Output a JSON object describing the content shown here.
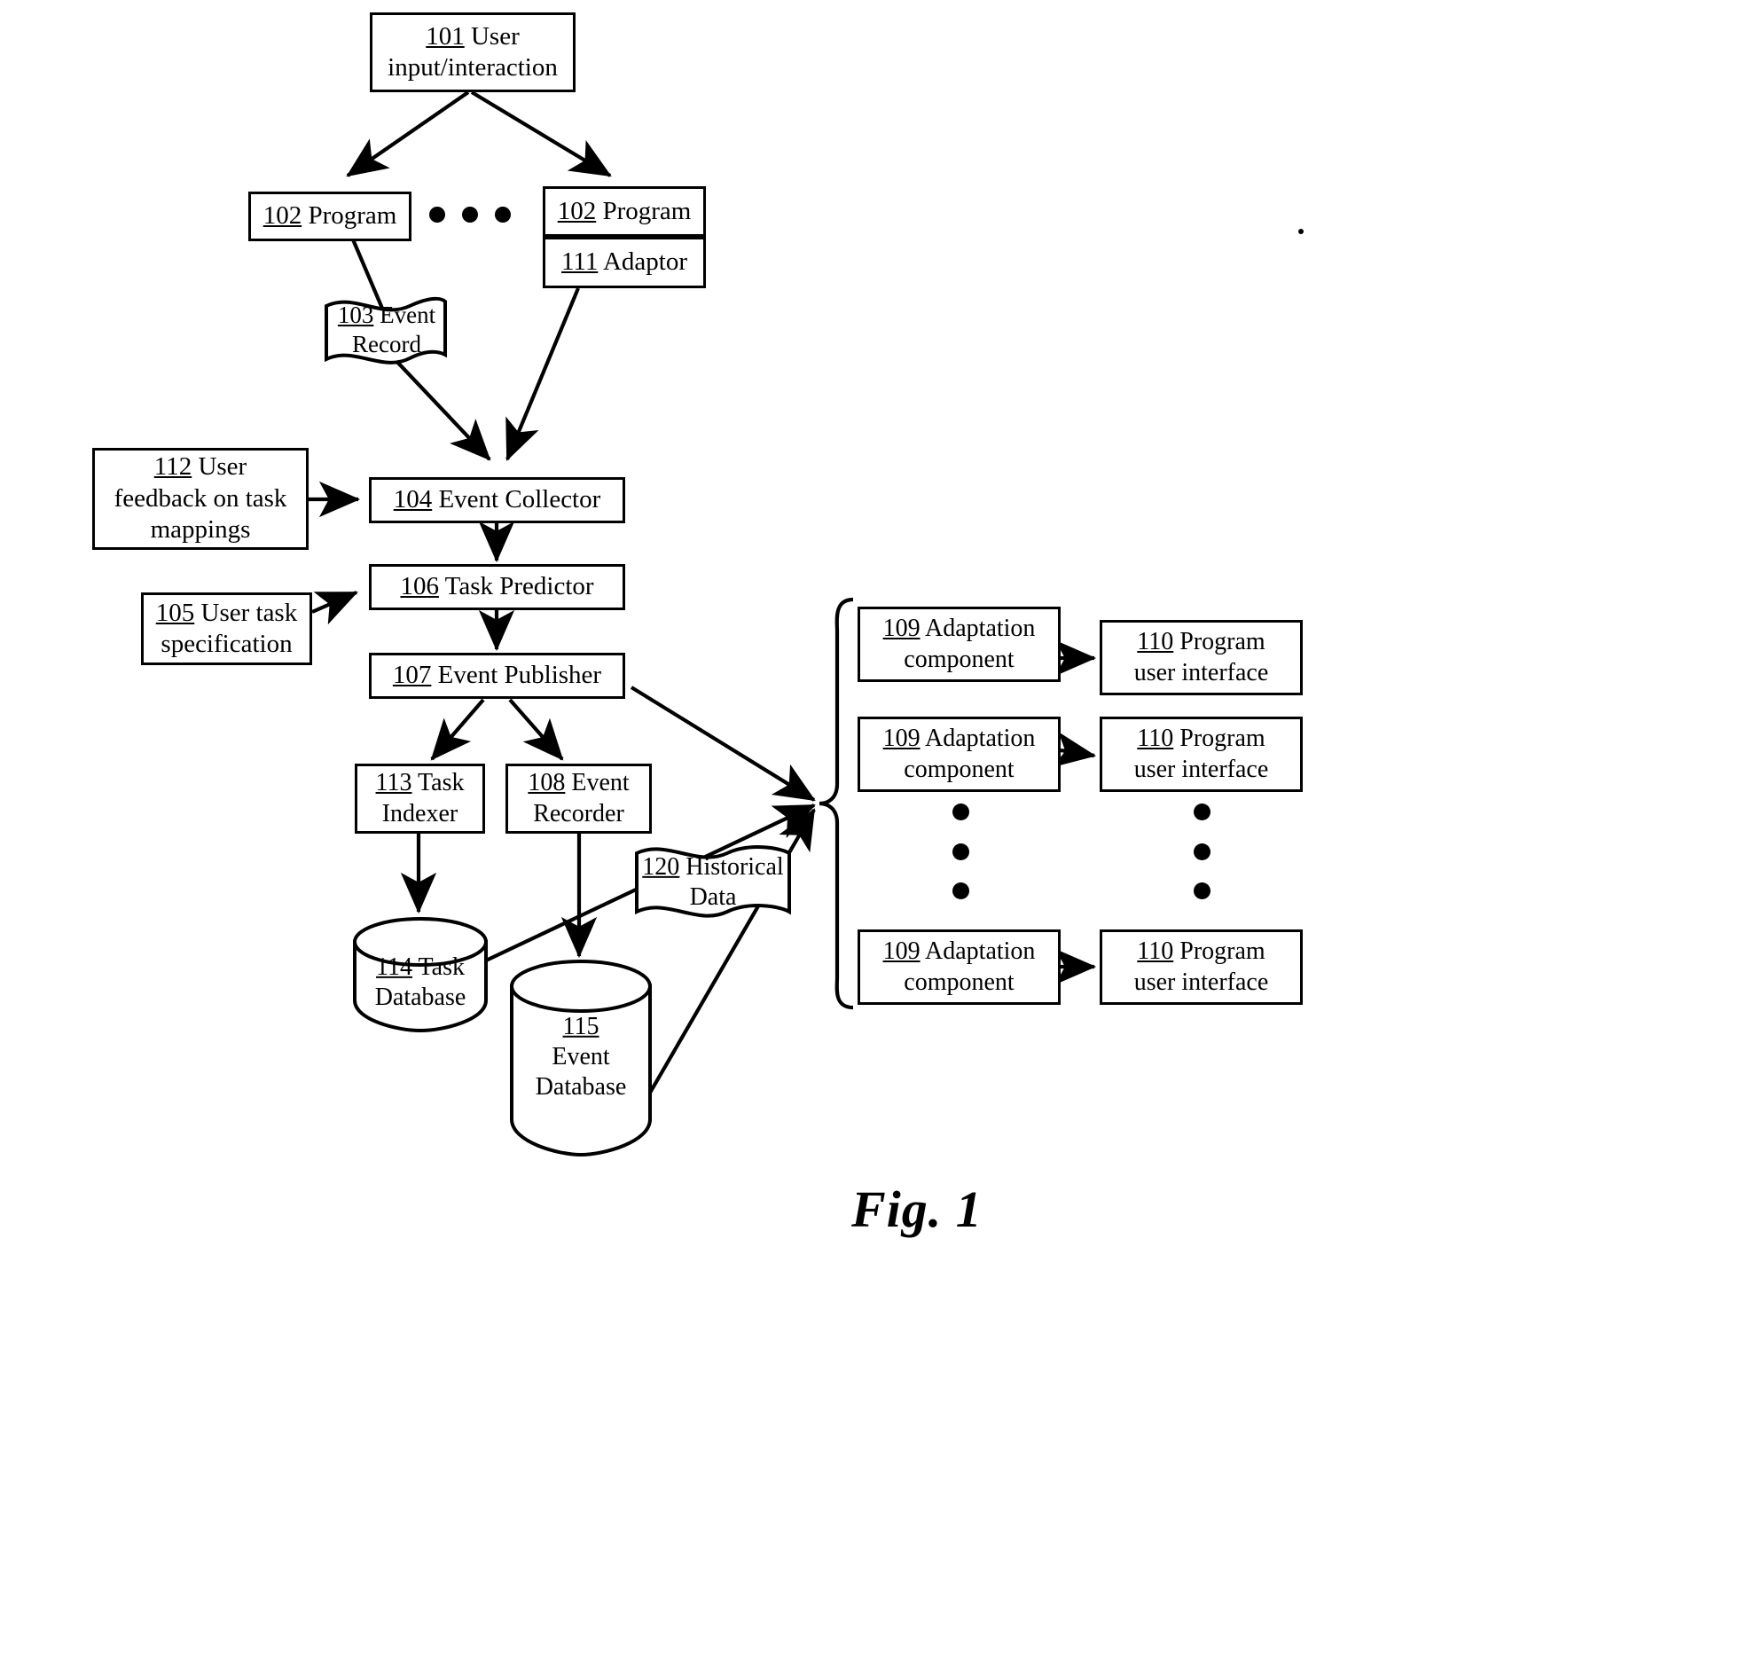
{
  "figure": {
    "caption": "Fig. 1",
    "title": "Task prediction and program adaptation system block diagram"
  },
  "nodes": {
    "n101": {
      "ref": "101",
      "text": " User input/interaction",
      "line1": "101 User",
      "line2": "input/interaction"
    },
    "n102a": {
      "ref": "102",
      "text": " Program"
    },
    "n102b": {
      "ref": "102",
      "text": " Program"
    },
    "n111": {
      "ref": "111",
      "text": " Adaptor"
    },
    "n103": {
      "ref": "103",
      "line1": " Event",
      "line2": "Record"
    },
    "n112": {
      "ref": "112",
      "line1": " User",
      "line2": "feedback on task",
      "line3": "mappings"
    },
    "n104": {
      "ref": "104",
      "text": " Event Collector"
    },
    "n105": {
      "ref": "105",
      "line1": " User task",
      "line2": "specification"
    },
    "n106": {
      "ref": "106",
      "text": " Task Predictor"
    },
    "n107": {
      "ref": "107",
      "text": " Event Publisher"
    },
    "n113": {
      "ref": "113",
      "line1": " Task",
      "line2": "Indexer"
    },
    "n108": {
      "ref": "108",
      "line1": " Event",
      "line2": "Recorder"
    },
    "n120": {
      "ref": "120",
      "line1": " Historical",
      "line2": "Data"
    },
    "n114": {
      "ref": "114",
      "line1": " Task",
      "line2": "Database"
    },
    "n115": {
      "ref": "115",
      "line1": "",
      "line2": "Event",
      "line3": "Database"
    },
    "n109a": {
      "ref": "109",
      "line1": " Adaptation",
      "line2": "component"
    },
    "n109b": {
      "ref": "109",
      "line1": " Adaptation",
      "line2": "component"
    },
    "n109c": {
      "ref": "109",
      "line1": " Adaptation",
      "line2": "component"
    },
    "n110a": {
      "ref": "110",
      "line1": " Program",
      "line2": "user interface"
    },
    "n110b": {
      "ref": "110",
      "line1": " Program",
      "line2": "user interface"
    },
    "n110c": {
      "ref": "110",
      "line1": " Program",
      "line2": "user interface"
    }
  },
  "ellipsis": {
    "programs_horizontal": "• • •",
    "adaptation_vertical": "•\n•\n•",
    "interface_vertical": "•\n•\n•"
  },
  "chart_data": {
    "type": "diagram",
    "title": "Fig. 1",
    "nodes": [
      {
        "id": "101",
        "label": "User input/interaction",
        "shape": "rect"
      },
      {
        "id": "102",
        "label": "Program",
        "shape": "rect"
      },
      {
        "id": "102b",
        "label": "Program",
        "shape": "rect"
      },
      {
        "id": "111",
        "label": "Adaptor",
        "shape": "rect"
      },
      {
        "id": "103",
        "label": "Event Record",
        "shape": "document"
      },
      {
        "id": "112",
        "label": "User feedback on task mappings",
        "shape": "rect"
      },
      {
        "id": "104",
        "label": "Event Collector",
        "shape": "rect"
      },
      {
        "id": "105",
        "label": "User task specification",
        "shape": "rect"
      },
      {
        "id": "106",
        "label": "Task Predictor",
        "shape": "rect"
      },
      {
        "id": "107",
        "label": "Event Publisher",
        "shape": "rect"
      },
      {
        "id": "113",
        "label": "Task Indexer",
        "shape": "rect"
      },
      {
        "id": "108",
        "label": "Event Recorder",
        "shape": "rect"
      },
      {
        "id": "120",
        "label": "Historical Data",
        "shape": "document"
      },
      {
        "id": "114",
        "label": "Task Database",
        "shape": "cylinder"
      },
      {
        "id": "115",
        "label": "Event Database",
        "shape": "cylinder"
      },
      {
        "id": "109",
        "label": "Adaptation component",
        "shape": "rect",
        "repeat": 3
      },
      {
        "id": "110",
        "label": "Program user interface",
        "shape": "rect",
        "repeat": 3
      }
    ],
    "edges": [
      {
        "from": "101",
        "to": "102"
      },
      {
        "from": "101",
        "to": "102b"
      },
      {
        "from": "102",
        "to": "103"
      },
      {
        "from": "103",
        "to": "104"
      },
      {
        "from": "111",
        "to": "104"
      },
      {
        "from": "112",
        "to": "104"
      },
      {
        "from": "104",
        "to": "106"
      },
      {
        "from": "105",
        "to": "106"
      },
      {
        "from": "106",
        "to": "107"
      },
      {
        "from": "107",
        "to": "113"
      },
      {
        "from": "107",
        "to": "108"
      },
      {
        "from": "107",
        "to": "109"
      },
      {
        "from": "113",
        "to": "114"
      },
      {
        "from": "108",
        "to": "115"
      },
      {
        "from": "114",
        "to": "109"
      },
      {
        "from": "115",
        "to": "109"
      },
      {
        "from": "120",
        "to": "109"
      },
      {
        "from": "109",
        "to": "110"
      }
    ]
  }
}
